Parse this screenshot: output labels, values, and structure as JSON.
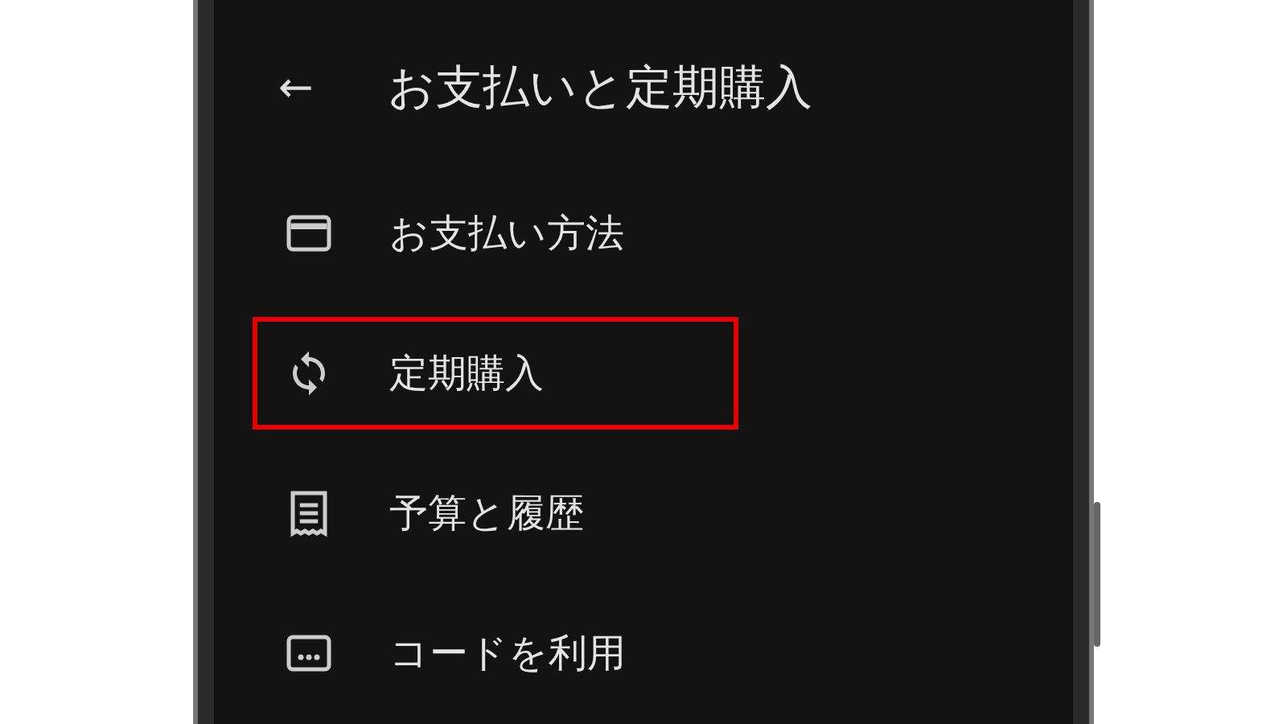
{
  "header": {
    "back": "←",
    "title": "お支払いと定期購入"
  },
  "items": [
    {
      "kind": "card",
      "label": "お支払い方法",
      "highlighted": false
    },
    {
      "kind": "sync",
      "label": "定期購入",
      "highlighted": true
    },
    {
      "kind": "receipt",
      "label": "予算と履歴",
      "highlighted": false
    },
    {
      "kind": "code",
      "label": "コードを利用",
      "highlighted": false
    }
  ]
}
